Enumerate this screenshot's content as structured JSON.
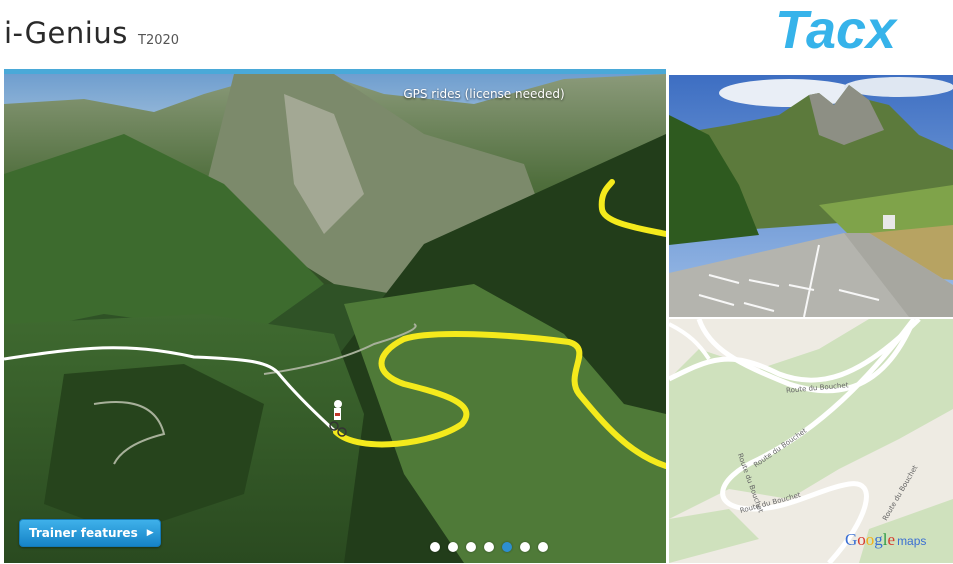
{
  "header": {
    "title": "i-Genius",
    "model": "T2020",
    "brand": "Tacx"
  },
  "slider": {
    "caption": "GPS rides (license needed)",
    "cta_label": "Trainer features",
    "total_slides": 7,
    "active_slide": 5
  },
  "map": {
    "road_labels": [
      "Route du Bouchet",
      "Route du Bouchet",
      "Route du Bouchet",
      "Route du Bouchet",
      "Route du Bouchet"
    ],
    "attribution_google": "Google",
    "attribution_maps": "maps"
  },
  "colors": {
    "accent": "#4aa9d8",
    "brand": "#36b3ea",
    "route_yellow": "#f4ea1c",
    "active_dot": "#2d8fd0"
  }
}
